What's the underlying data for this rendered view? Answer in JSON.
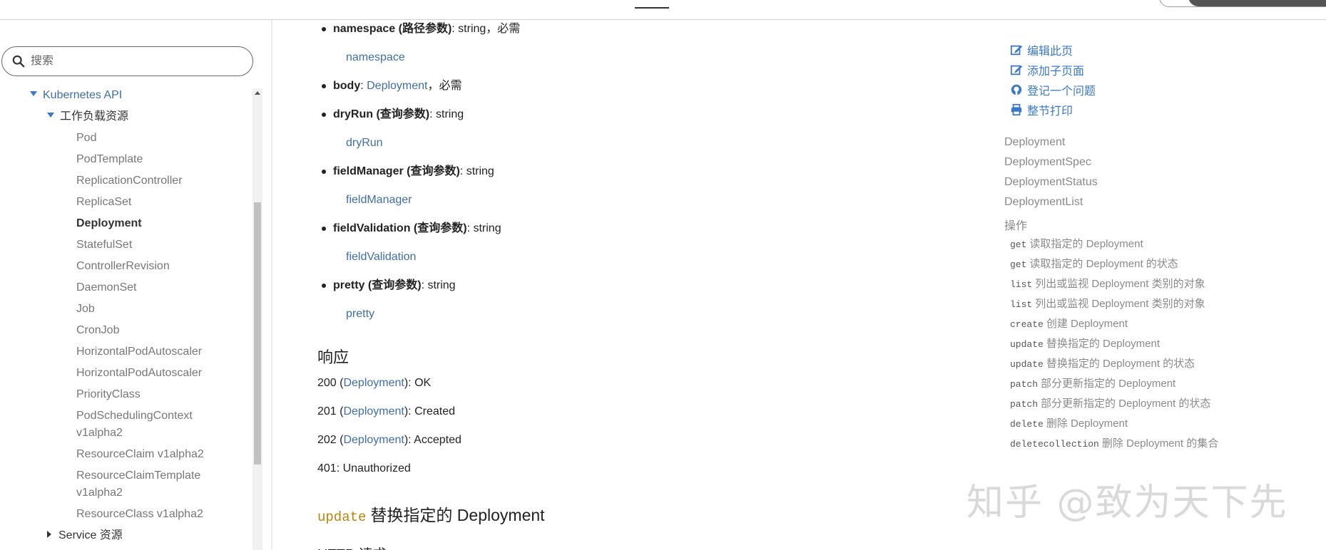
{
  "search": {
    "placeholder": "搜索"
  },
  "sidebar": {
    "root": "Kubernetes API",
    "group": "工作负载资源",
    "items": [
      "Pod",
      "PodTemplate",
      "ReplicationController",
      "ReplicaSet",
      "Deployment",
      "StatefulSet",
      "ControllerRevision",
      "DaemonSet",
      "Job",
      "CronJob",
      "HorizontalPodAutoscaler",
      "HorizontalPodAutoscaler",
      "PriorityClass",
      "PodSchedulingContext",
      "v1alpha2",
      "ResourceClaim v1alpha2",
      "ResourceClaimTemplate",
      "v1alpha2",
      "ResourceClass v1alpha2"
    ],
    "next_group": "Service 资源"
  },
  "params": [
    {
      "name": "namespace",
      "kind": " (路径参数)",
      "type": ": string，必需",
      "link": "namespace"
    },
    {
      "name": "body",
      "colon": ": ",
      "type_link": "Deployment",
      "type": "，必需"
    },
    {
      "name": "dryRun",
      "kind": " (查询参数)",
      "type": ": string",
      "link": "dryRun"
    },
    {
      "name": "fieldManager",
      "kind": " (查询参数)",
      "type": ": string",
      "link": "fieldManager"
    },
    {
      "name": "fieldValidation",
      "kind": " (查询参数)",
      "type": ": string",
      "link": "fieldValidation"
    },
    {
      "name": "pretty",
      "kind": " (查询参数)",
      "type": ": string",
      "link": "pretty"
    }
  ],
  "response": {
    "heading": "响应",
    "lines": [
      {
        "code": "200 (",
        "link": "Deployment",
        "rest": "): OK"
      },
      {
        "code": "201 (",
        "link": "Deployment",
        "rest": "): Created"
      },
      {
        "code": "202 (",
        "link": "Deployment",
        "rest": "): Accepted"
      },
      {
        "code": "401: Unauthorized"
      }
    ]
  },
  "update_heading": {
    "verb": "update",
    "text": "替换指定的 Deployment"
  },
  "http_heading": "HTTP 请求",
  "toc": {
    "actions": [
      "编辑此页",
      "添加子页面",
      "登记一个问题",
      "整节打印"
    ],
    "items": [
      "Deployment",
      "DeploymentSpec",
      "DeploymentStatus",
      "DeploymentList",
      "操作"
    ],
    "ops": [
      {
        "verb": "get",
        "text": "读取指定的 Deployment"
      },
      {
        "verb": "get",
        "text": "读取指定的 Deployment 的状态"
      },
      {
        "verb": "list",
        "text": "列出或监视 Deployment 类别的对象"
      },
      {
        "verb": "list",
        "text": "列出或监视 Deployment 类别的对象"
      },
      {
        "verb": "create",
        "text": "创建 Deployment"
      },
      {
        "verb": "update",
        "text": "替换指定的 Deployment"
      },
      {
        "verb": "update",
        "text": "替换指定的 Deployment 的状态"
      },
      {
        "verb": "patch",
        "text": "部分更新指定的 Deployment"
      },
      {
        "verb": "patch",
        "text": "部分更新指定的 Deployment 的状态"
      },
      {
        "verb": "delete",
        "text": "删除 Deployment"
      },
      {
        "verb": "deletecollection",
        "text": "删除 Deployment 的集合"
      }
    ]
  },
  "watermark": "知乎 @致为天下先",
  "colors": {
    "link": "#3f6ea8",
    "action": "#3a78c9",
    "code_verb": "#b8860b"
  }
}
